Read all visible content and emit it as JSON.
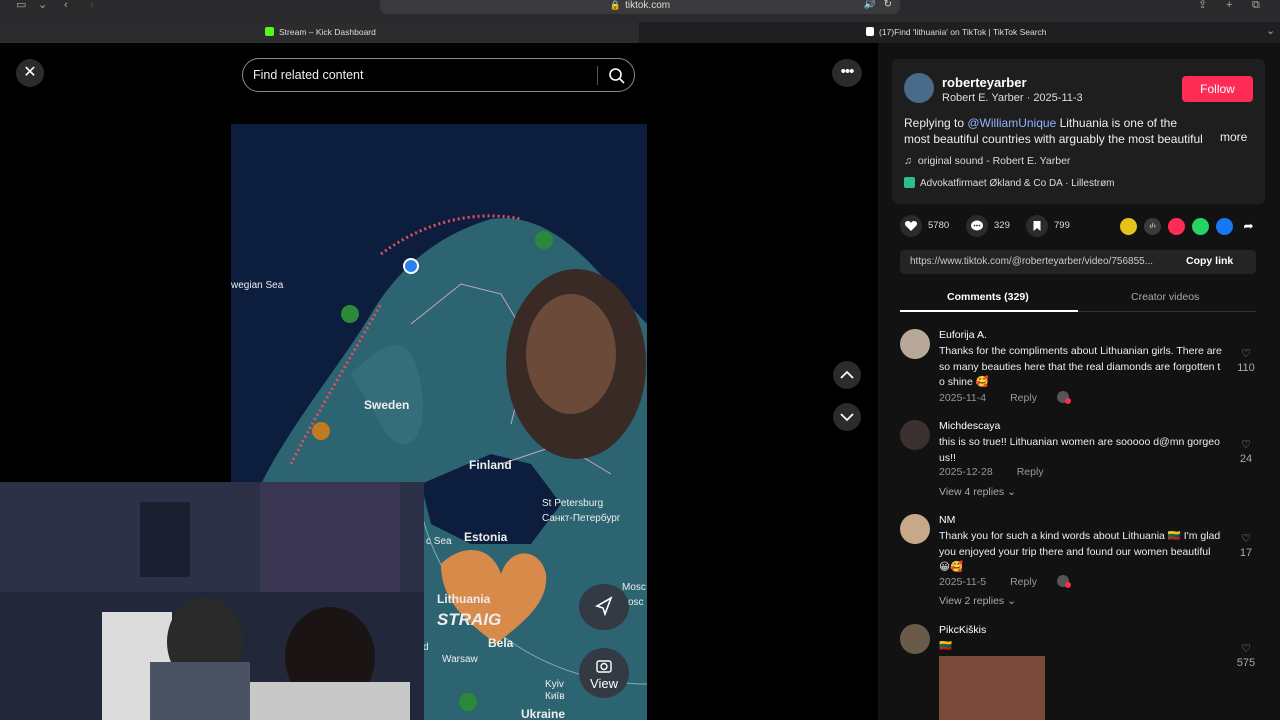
{
  "browser": {
    "address": "tiktok.com",
    "tabs": [
      {
        "title": "Stream – Kick Dashboard",
        "favicon_color": "#53fc18"
      },
      {
        "title": "(17)Find 'lithuania' on TikTok | TikTok Search",
        "favicon_color": "#ffffff"
      }
    ]
  },
  "search": {
    "placeholder": "Find related content"
  },
  "map": {
    "labels": [
      "wegian Sea",
      "Sweden",
      "Finland",
      "St Petersburg",
      "Санкт-Петербург",
      "Estonia",
      "c Sea",
      "Lithuania",
      "STRAIG",
      "Bela",
      "Warsaw",
      "Mosc",
      "osc",
      "Kyiv",
      "Київ",
      "Ukraine",
      "d"
    ],
    "view_label": "View"
  },
  "post": {
    "username": "roberteyarber",
    "author": "Robert E. Yarber",
    "date": "2025-11-3",
    "follow_label": "Follow",
    "desc_prefix": "Replying to ",
    "mention": "@WilliamUnique",
    "desc_rest": " Lithuania is one of the most beautiful countries with arguably the most beautiful",
    "more_label": "more",
    "sound": "original sound - Robert E. Yarber",
    "location": "Advokatfirmaet Økland & Co DA · Lillestrøm",
    "likes": "5780",
    "comments": "329",
    "saves": "799",
    "url": "https://www.tiktok.com/@roberteyarber/video/756855...",
    "copy_label": "Copy link"
  },
  "tabs": {
    "comments": "Comments (329)",
    "creator": "Creator videos"
  },
  "comments": [
    {
      "name": "Euforija A.",
      "text": "Thanks for the compliments about Lithuanian girls. There are so many beauties here that the real diamonds are forgotten to shine 🥰",
      "date": "2025-11-4",
      "reply": "Reply",
      "likes": "110"
    },
    {
      "name": "Michdescaya",
      "text": "this is so true!! Lithuanian women are sooooo d@mn gorgeous!!",
      "date": "2025-12-28",
      "reply": "Reply",
      "likes": "24",
      "view_replies": "View 4 replies ⌄"
    },
    {
      "name": "NM",
      "text": "Thank you for such a kind words about Lithuania 🇱🇹 I'm glad you enjoyed your trip there and found our women beautiful 😀🥰",
      "date": "2025-11-5",
      "reply": "Reply",
      "likes": "17",
      "view_replies": "View 2 replies ⌄"
    },
    {
      "name": "PikcKiškis",
      "text": "🇱🇹",
      "likes": "575"
    }
  ]
}
